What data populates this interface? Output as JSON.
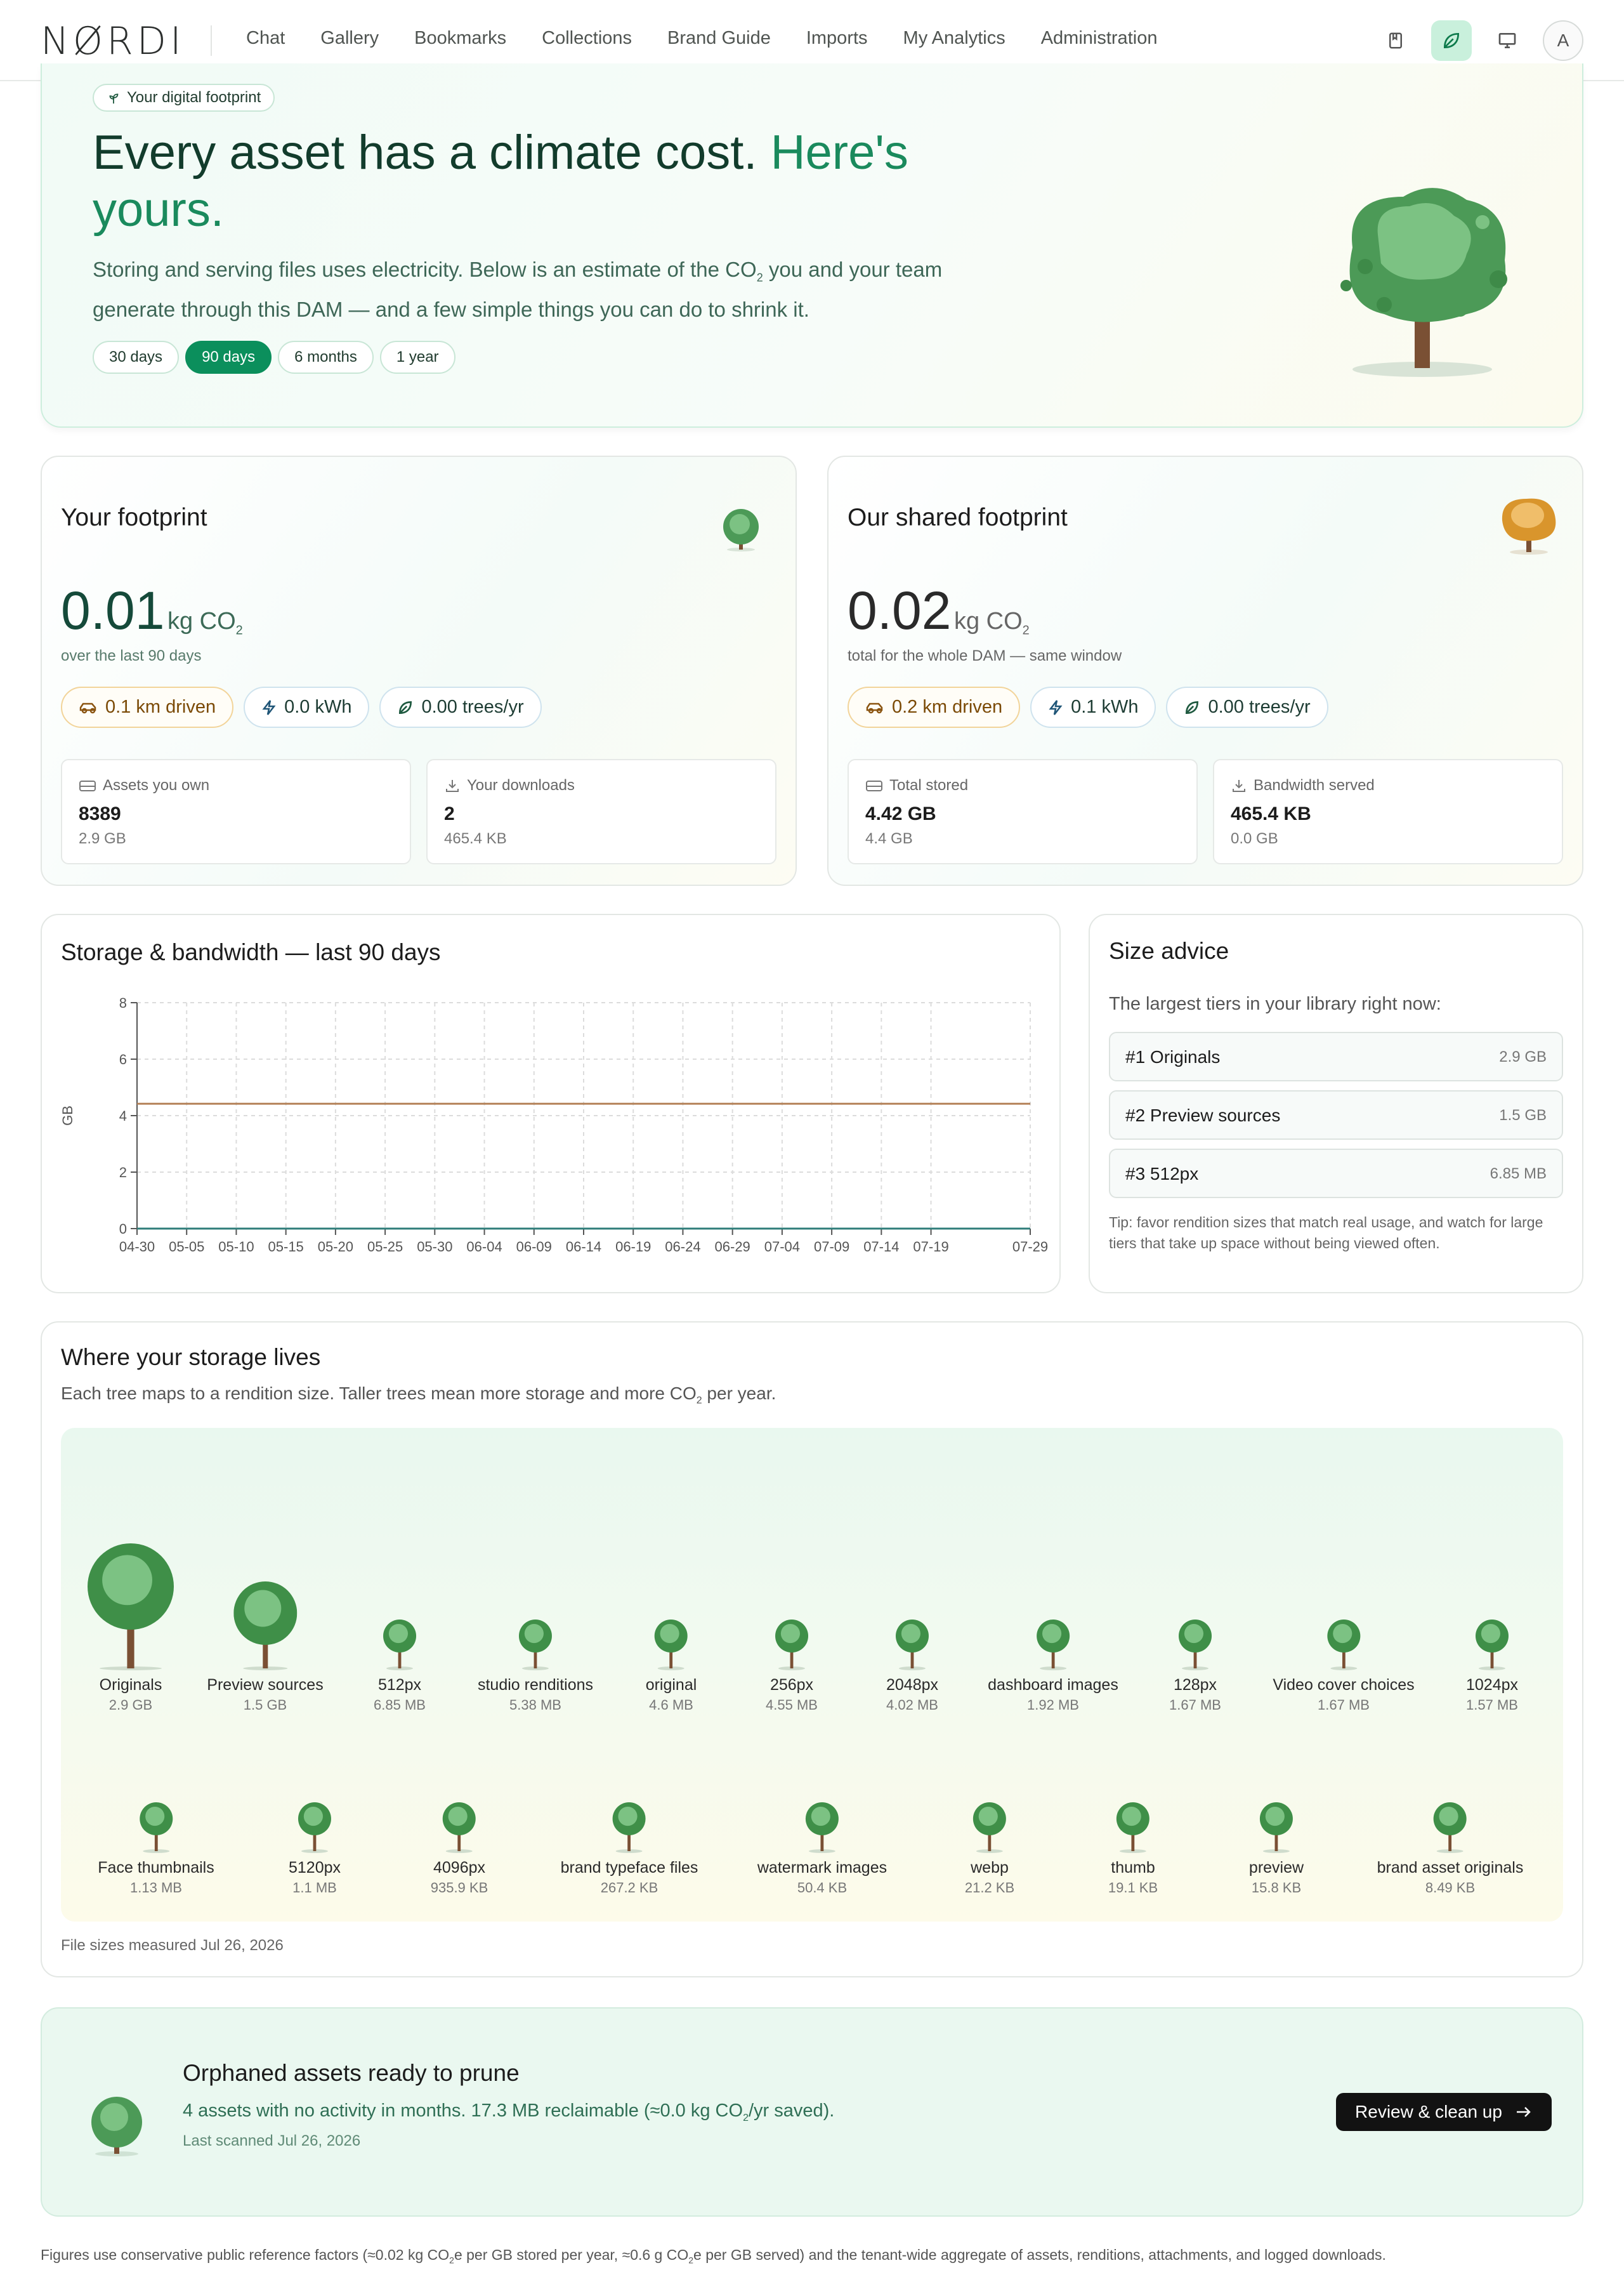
{
  "nav": {
    "logo": "NØRDI",
    "links": [
      "Chat",
      "Gallery",
      "Bookmarks",
      "Collections",
      "Brand Guide",
      "Imports",
      "My Analytics",
      "Administration"
    ],
    "avatar": "A",
    "icons": [
      "bookmark-book-icon",
      "leaf-icon",
      "monitor-icon"
    ]
  },
  "hero": {
    "badge": "Your digital footprint",
    "title_a": "Every asset has a climate cost.",
    "title_b": "Here's yours.",
    "lead_1": "Storing and serving files uses electricity. Below is an estimate of the CO",
    "lead_sub": "2",
    "lead_2": " you and your team generate through this DAM — and a few simple things you can do to shrink it.",
    "ranges": [
      "30 days",
      "90 days",
      "6 months",
      "1 year"
    ],
    "active_range": "90 days"
  },
  "your_footprint": {
    "title": "Your footprint",
    "value": "0.01",
    "unit": "kg CO",
    "unit_sub": "2",
    "caption": "over the last 90 days",
    "chips": {
      "driven": "0.1 km driven",
      "kwh": "0.0 kWh",
      "trees": "0.00 trees/yr"
    },
    "stats": [
      {
        "label": "Assets you own",
        "value": "8389",
        "small": "2.9 GB"
      },
      {
        "label": "Your downloads",
        "value": "2",
        "small": "465.4 KB"
      }
    ]
  },
  "shared_footprint": {
    "title": "Our shared footprint",
    "value": "0.02",
    "unit": "kg CO",
    "unit_sub": "2",
    "caption": "total for the whole DAM — same window",
    "chips": {
      "driven": "0.2 km driven",
      "kwh": "0.1 kWh",
      "trees": "0.00 trees/yr"
    },
    "stats": [
      {
        "label": "Total stored",
        "value": "4.42 GB",
        "small": "4.4 GB"
      },
      {
        "label": "Bandwidth served",
        "value": "465.4 KB",
        "small": "0.0 GB"
      }
    ]
  },
  "chart_panel": {
    "title": "Storage & bandwidth — last 90 days"
  },
  "chart_data": {
    "type": "line",
    "ylabel": "GB",
    "xlabel": "",
    "ylim": [
      0,
      8
    ],
    "yticks": [
      0,
      2,
      4,
      6,
      8
    ],
    "x_ticks": [
      "04-30",
      "05-05",
      "05-10",
      "05-15",
      "05-20",
      "05-25",
      "05-30",
      "06-04",
      "06-09",
      "06-14",
      "06-19",
      "06-24",
      "06-29",
      "07-04",
      "07-09",
      "07-14",
      "07-19",
      "07-29"
    ],
    "x_range": [
      "04-30",
      "07-29"
    ],
    "grid": true,
    "series": [
      {
        "values": [
          4.42,
          4.42
        ],
        "x": [
          "04-30",
          "07-29"
        ],
        "color": "#b5835a"
      },
      {
        "values": [
          0.0,
          0.0
        ],
        "x": [
          "04-30",
          "07-29"
        ],
        "color": "#2f7d7a"
      }
    ]
  },
  "advice": {
    "title": "Size advice",
    "intro": "The largest tiers in your library right now:",
    "rows": [
      {
        "name": "#1 Originals",
        "size": "2.9 GB"
      },
      {
        "name": "#2 Preview sources",
        "size": "1.5 GB"
      },
      {
        "name": "#3 512px",
        "size": "6.85 MB"
      }
    ],
    "tip": "Tip: favor rendition sizes that match real usage, and watch for large tiers that take up space without being viewed often."
  },
  "storage": {
    "title": "Where your storage lives",
    "desc_1": "Each tree maps to a rendition size. Taller trees mean more storage and more CO",
    "desc_sub": "2",
    "desc_2": " per year.",
    "measured": "File sizes measured Jul 26, 2026",
    "trees": [
      {
        "name": "Originals",
        "size": "2.9 GB"
      },
      {
        "name": "Preview sources",
        "size": "1.5 GB"
      },
      {
        "name": "512px",
        "size": "6.85 MB"
      },
      {
        "name": "studio renditions",
        "size": "5.38 MB"
      },
      {
        "name": "original",
        "size": "4.6 MB"
      },
      {
        "name": "256px",
        "size": "4.55 MB"
      },
      {
        "name": "2048px",
        "size": "4.02 MB"
      },
      {
        "name": "dashboard images",
        "size": "1.92 MB"
      },
      {
        "name": "128px",
        "size": "1.67 MB"
      },
      {
        "name": "Video cover choices",
        "size": "1.67 MB"
      },
      {
        "name": "1024px",
        "size": "1.57 MB"
      },
      {
        "name": "Face thumbnails",
        "size": "1.13 MB"
      },
      {
        "name": "5120px",
        "size": "1.1 MB"
      },
      {
        "name": "4096px",
        "size": "935.9 KB"
      },
      {
        "name": "brand typeface files",
        "size": "267.2 KB"
      },
      {
        "name": "watermark images",
        "size": "50.4 KB"
      },
      {
        "name": "webp",
        "size": "21.2 KB"
      },
      {
        "name": "thumb",
        "size": "19.1 KB"
      },
      {
        "name": "preview",
        "size": "15.8 KB"
      },
      {
        "name": "brand asset originals",
        "size": "8.49 KB"
      }
    ]
  },
  "orphaned": {
    "title": "Orphaned assets ready to prune",
    "desc_1": "4 assets with no activity in months. 17.3 MB reclaimable (≈0.0 kg CO",
    "desc_sub": "2",
    "desc_2": "/yr saved).",
    "scanned": "Last scanned Jul 26, 2026",
    "button": "Review & clean up"
  },
  "footer": {
    "p1": "Figures use conservative public reference factors (≈0.02 kg CO",
    "s1": "2",
    "p2": "e per GB stored per year, ≈0.6 g CO",
    "s2": "2",
    "p3": "e per GB served) and the tenant-wide aggregate of assets, renditions, attachments, and logged downloads."
  },
  "colors": {
    "accent": "#0b8f5c",
    "tree_green": "#3f8f48",
    "tree_orange": "#d9952c",
    "storage_line": "#b5835a",
    "bandwidth_line": "#2f7d7a"
  }
}
